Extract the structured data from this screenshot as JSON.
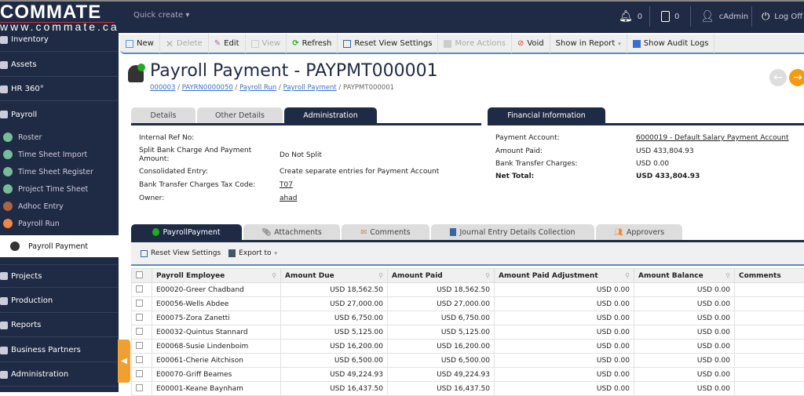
{
  "brand": {
    "name": "COMMATE",
    "url": "www.commate.ca"
  },
  "topbar": {
    "quick_create": "Quick create",
    "notifications": "0",
    "documents": "0",
    "user": "cAdmin",
    "logoff": "Log Off"
  },
  "sidebar": {
    "items": [
      {
        "label": "Inventory"
      },
      {
        "label": "Assets"
      },
      {
        "label": "HR 360°"
      },
      {
        "label": "Payroll"
      },
      {
        "label": "Projects"
      },
      {
        "label": "Production"
      },
      {
        "label": "Reports"
      },
      {
        "label": "Business Partners"
      },
      {
        "label": "Administration"
      }
    ],
    "payroll_sub": [
      {
        "label": "Roster"
      },
      {
        "label": "Time Sheet Import"
      },
      {
        "label": "Time Sheet Register"
      },
      {
        "label": "Project Time Sheet"
      },
      {
        "label": "Adhoc Entry"
      },
      {
        "label": "Payroll Run"
      },
      {
        "label": "Payroll Payment"
      }
    ]
  },
  "toolbar": {
    "new": "New",
    "delete": "Delete",
    "edit": "Edit",
    "view": "View",
    "refresh": "Refresh",
    "reset": "Reset View Settings",
    "more": "More Actions",
    "void": "Void",
    "report": "Show in Report",
    "audit": "Show Audit Logs"
  },
  "page": {
    "title": "Payroll Payment - PAYPMT000001",
    "breadcrumb": [
      "000003",
      "PAYRN0000050",
      "Payroll Run",
      "Payroll Payment",
      "PAYPMT000001"
    ]
  },
  "tabs": [
    "Details",
    "Other Details",
    "Administration"
  ],
  "admin": {
    "fields": [
      {
        "label": "Internal Ref No:",
        "value": ""
      },
      {
        "label": "Split Bank Charge And Payment Amount:",
        "value": "Do Not Split"
      },
      {
        "label": "Consolidated Entry:",
        "value": "Create separate entries for Payment Account"
      },
      {
        "label": "Bank Transfer Charges Tax Code:",
        "value": "T07"
      },
      {
        "label": "Owner:",
        "value": "ahad"
      }
    ]
  },
  "financial": {
    "title": "Financial Information",
    "fields": [
      {
        "label": "Payment Account:",
        "value": "6000019 - Default Salary Payment Account"
      },
      {
        "label": "Amount Paid:",
        "value": "USD 433,804.93"
      },
      {
        "label": "Bank Transfer Charges:",
        "value": "USD 0.00"
      },
      {
        "label": "Net Total:",
        "value": "USD 433,804.93"
      }
    ]
  },
  "detail_tabs": [
    "PayrollPayment",
    "Attachments",
    "Comments",
    "Journal Entry Details Collection",
    "Approvers"
  ],
  "grid_toolbar": {
    "reset": "Reset View Settings",
    "export": "Export to"
  },
  "grid": {
    "columns": [
      "Payroll Employee",
      "Amount Due",
      "Amount Paid",
      "Amount Paid Adjustment",
      "Amount Balance",
      "Comments"
    ],
    "rows": [
      [
        "E00020-Greer Chadband",
        "USD 18,562.50",
        "USD 18,562.50",
        "USD 0.00",
        "USD 0.00",
        ""
      ],
      [
        "E00056-Wells Abdee",
        "USD 27,000.00",
        "USD 27,000.00",
        "USD 0.00",
        "USD 0.00",
        ""
      ],
      [
        "E00075-Zora Zanetti",
        "USD 6,750.00",
        "USD 6,750.00",
        "USD 0.00",
        "USD 0.00",
        ""
      ],
      [
        "E00032-Quintus Stannard",
        "USD 5,125.00",
        "USD 5,125.00",
        "USD 0.00",
        "USD 0.00",
        ""
      ],
      [
        "E00068-Susie Lindenboim",
        "USD 16,200.00",
        "USD 16,200.00",
        "USD 0.00",
        "USD 0.00",
        ""
      ],
      [
        "E00061-Cherie Aitchison",
        "USD 6,500.00",
        "USD 6,500.00",
        "USD 0.00",
        "USD 0.00",
        ""
      ],
      [
        "E00070-Griff Beames",
        "USD 49,224.93",
        "USD 49,224.93",
        "USD 0.00",
        "USD 0.00",
        ""
      ],
      [
        "E00001-Keane Baynham",
        "USD 16,437.50",
        "USD 16,437.50",
        "USD 0.00",
        "USD 0.00",
        ""
      ]
    ]
  }
}
